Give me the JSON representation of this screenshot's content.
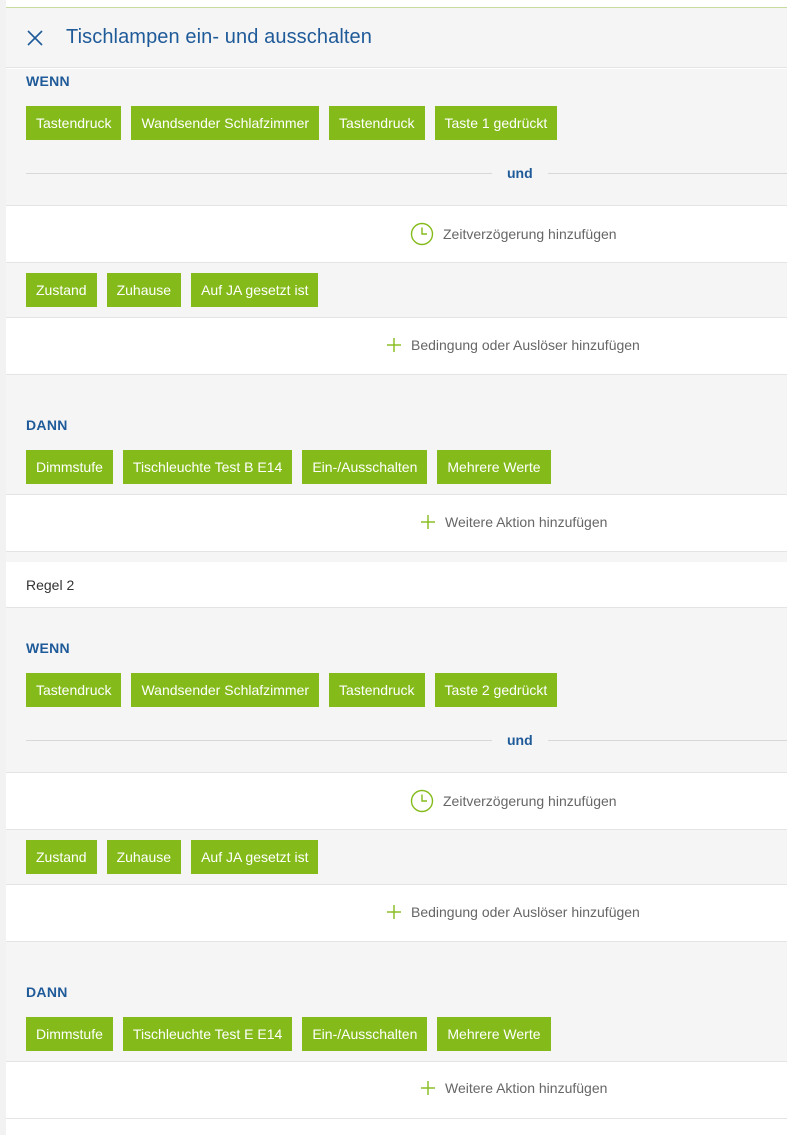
{
  "header": {
    "title": "Tischlampen ein- und ausschalten",
    "close_icon": "close-icon"
  },
  "colors": {
    "accent_green": "#84bb1a",
    "title_blue": "#1f5a99",
    "background_grey": "#f5f5f5"
  },
  "rules": [
    {
      "wenn_label": "WENN",
      "trigger_chips": [
        "Tastendruck",
        "Wandsender Schlafzimmer",
        "Tastendruck",
        "Taste 1 gedrückt"
      ],
      "und_label": "und",
      "delay_label": "Zeitverzögerung hinzufügen",
      "condition_chips": [
        "Zustand",
        "Zuhause",
        "Auf JA gesetzt ist"
      ],
      "add_condition_label": "Bedingung oder Auslöser hinzufügen",
      "dann_label": "DANN",
      "action_chips": [
        "Dimmstufe",
        "Tischleuchte Test B E14",
        "Ein-/Ausschalten",
        "Mehrere Werte"
      ],
      "add_action_label": "Weitere Aktion hinzufügen"
    },
    {
      "title": "Regel 2",
      "wenn_label": "WENN",
      "trigger_chips": [
        "Tastendruck",
        "Wandsender Schlafzimmer",
        "Tastendruck",
        "Taste 2 gedrückt"
      ],
      "und_label": "und",
      "delay_label": "Zeitverzögerung hinzufügen",
      "condition_chips": [
        "Zustand",
        "Zuhause",
        "Auf JA gesetzt ist"
      ],
      "add_condition_label": "Bedingung oder Auslöser hinzufügen",
      "dann_label": "DANN",
      "action_chips": [
        "Dimmstufe",
        "Tischleuchte Test E E14",
        "Ein-/Ausschalten",
        "Mehrere Werte"
      ],
      "add_action_label": "Weitere Aktion hinzufügen"
    }
  ]
}
